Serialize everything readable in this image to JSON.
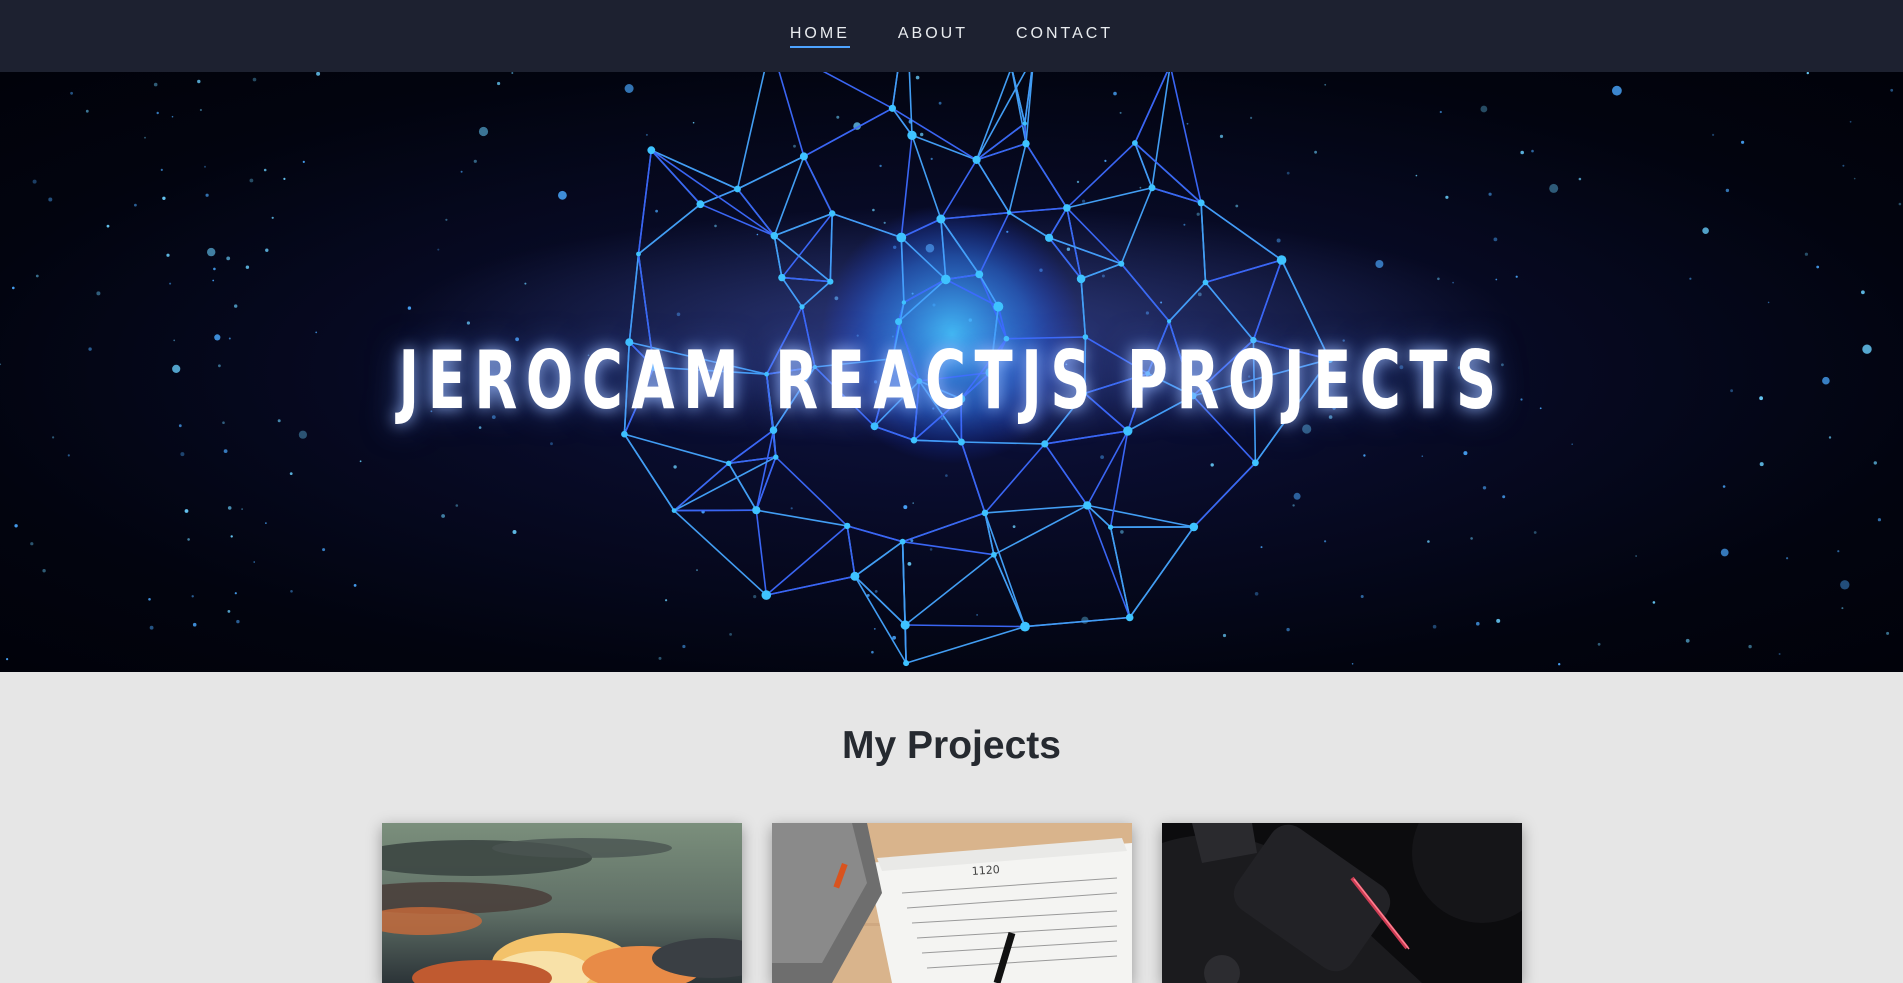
{
  "nav": {
    "items": [
      {
        "label": "HOME",
        "active": true
      },
      {
        "label": "ABOUT",
        "active": false
      },
      {
        "label": "CONTACT",
        "active": false
      }
    ]
  },
  "hero": {
    "title": "JEROCAM REACTJS PROJECTS"
  },
  "projects": {
    "title": "My Projects",
    "cards": [
      {
        "image": "sunset-clouds-image"
      },
      {
        "image": "tax-form-image"
      },
      {
        "image": "game-controller-image"
      }
    ]
  },
  "colors": {
    "nav_bg": "#1d2130",
    "nav_active_underline": "#4da3ff",
    "page_bg": "#e6e6e6",
    "hero_bg": "#02040f",
    "network_line": "#3d6bff",
    "network_glow": "#3ec3ff"
  }
}
